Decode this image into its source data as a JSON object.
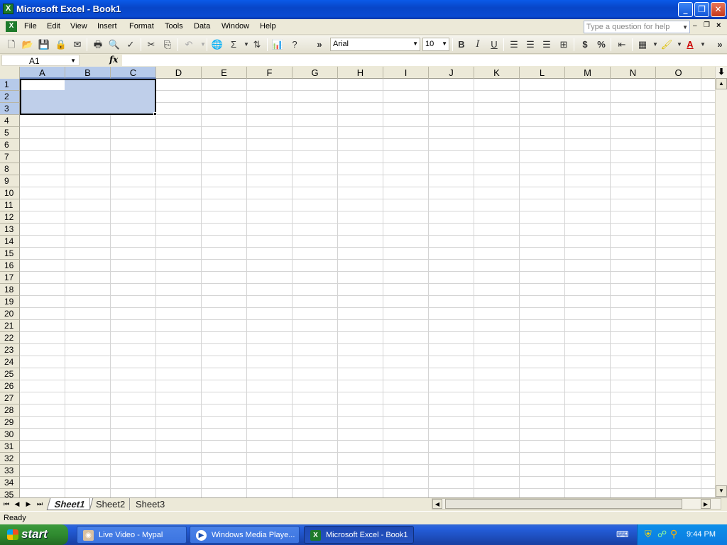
{
  "window": {
    "title": "Microsoft Excel - Book1",
    "app_icon": "excel-icon"
  },
  "menu": {
    "items": [
      "File",
      "Edit",
      "View",
      "Insert",
      "Format",
      "Tools",
      "Data",
      "Window",
      "Help"
    ],
    "help_placeholder": "Type a question for help"
  },
  "toolbar": {
    "font_name": "Arial",
    "font_size": "10",
    "bold": "B",
    "italic": "I",
    "underline": "U",
    "currency": "$",
    "percent": "%",
    "sum": "Σ",
    "more": "»"
  },
  "formula": {
    "name_box": "A1",
    "fx": "fx",
    "value": ""
  },
  "grid": {
    "columns": [
      "A",
      "B",
      "C",
      "D",
      "E",
      "F",
      "G",
      "H",
      "I",
      "J",
      "K",
      "L",
      "M",
      "N",
      "O"
    ],
    "rows": [
      "1",
      "2",
      "3",
      "4",
      "5",
      "6",
      "7",
      "8",
      "9",
      "10",
      "11",
      "12",
      "13",
      "14",
      "15",
      "16",
      "17",
      "18",
      "19",
      "20",
      "21",
      "22",
      "23",
      "24",
      "25",
      "26",
      "27",
      "28",
      "29",
      "30",
      "31",
      "32",
      "33",
      "34",
      "35"
    ],
    "selected_range": "A1:C3",
    "active_cell": "A1"
  },
  "sheets": {
    "tabs": [
      "Sheet1",
      "Sheet2",
      "Sheet3"
    ],
    "active": "Sheet1"
  },
  "status": {
    "text": "Ready"
  },
  "taskbar": {
    "start_label": "start",
    "tasks": [
      "Live Video - Mypal",
      "Windows Media Playe...",
      "Microsoft Excel - Book1"
    ],
    "clock": "9:44 PM"
  },
  "colors": {
    "selection": "#bfcfea",
    "title_bar": "#0a4ad2",
    "taskbar": "#245edb"
  }
}
